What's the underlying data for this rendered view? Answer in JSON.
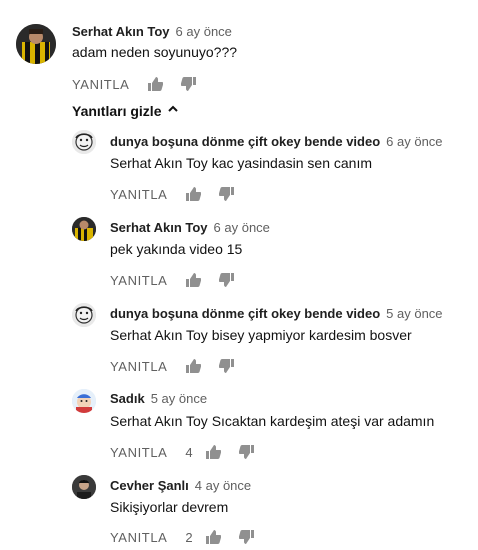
{
  "top_comment": {
    "author": "Serhat Akın Toy",
    "time": "6 ay önce",
    "text": "adam neden soyunuyo???",
    "reply_label": "YANITLA",
    "avatar_icon": "football-player-avatar-icon"
  },
  "hide_replies_label": "Yanıtları gizle",
  "replies": [
    {
      "author": "dunya boşuna dönme çift okey bende video",
      "time": "6 ay önce",
      "text": "Serhat Akın Toy  kac yasindasin sen canım",
      "reply_label": "YANITLA",
      "likes": ""
    },
    {
      "author": "Serhat Akın Toy",
      "time": "6 ay önce",
      "text": "pek yakında video 15",
      "reply_label": "YANITLA",
      "likes": ""
    },
    {
      "author": "dunya boşuna dönme çift okey bende video",
      "time": "5 ay önce",
      "text": "Serhat Akın Toy  bisey yapmiyor kardesim bosver",
      "reply_label": "YANITLA",
      "likes": ""
    },
    {
      "author": "Sadık",
      "time": "5 ay önce",
      "text": "Serhat Akın Toy Sıcaktan kardeşim ateşi var adamın",
      "reply_label": "YANITLA",
      "likes": "4"
    },
    {
      "author": "Cevher Şanlı",
      "time": "4 ay önce",
      "text": "Sikişiyorlar devrem",
      "reply_label": "YANITLA",
      "likes": "2"
    }
  ],
  "colors": {
    "meta_gray": "#606060",
    "icon_gray": "#909090"
  }
}
